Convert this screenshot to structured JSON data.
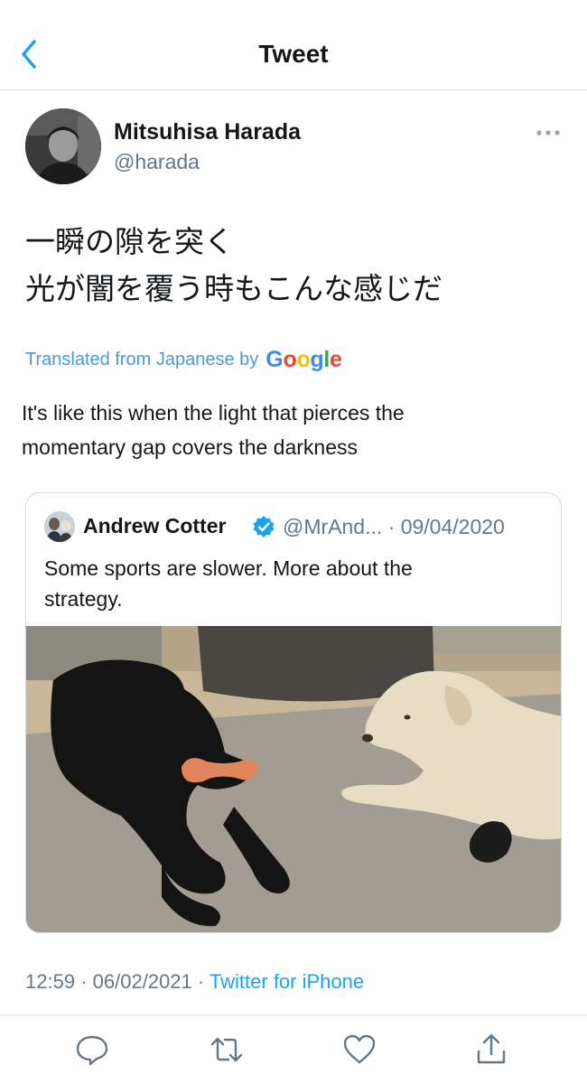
{
  "nav": {
    "title": "Tweet"
  },
  "tweet": {
    "author_name": "Mitsuhisa Harada",
    "author_handle": "@harada",
    "text_lines": [
      "一瞬の隙を突く",
      "光が闇を覆う時もこんな感じだ"
    ],
    "translated_label": "Translated from Japanese by",
    "translation_provider": "Google",
    "translation_lines": [
      "It's like this when the light that pierces the",
      "momentary gap covers the darkness"
    ],
    "time": "12:59",
    "date": "06/02/2021",
    "separator": "·",
    "source": "Twitter for iPhone"
  },
  "quoted": {
    "author_name": "Andrew Cotter",
    "author_handle": "@MrAnd...",
    "date": "· 09/04/2020",
    "text_lines": [
      "Some sports are slower. More about the",
      "strategy."
    ]
  },
  "colors": {
    "accent": "#1da1f2",
    "secondary_text": "#657786",
    "divider": "#dfe3e6"
  },
  "icons": {
    "back": "chevron-left-icon",
    "more": "more-dots-icon",
    "verified": "verified-badge-icon",
    "reply": "reply-icon",
    "retweet": "retweet-icon",
    "like": "heart-icon",
    "share": "share-icon"
  }
}
